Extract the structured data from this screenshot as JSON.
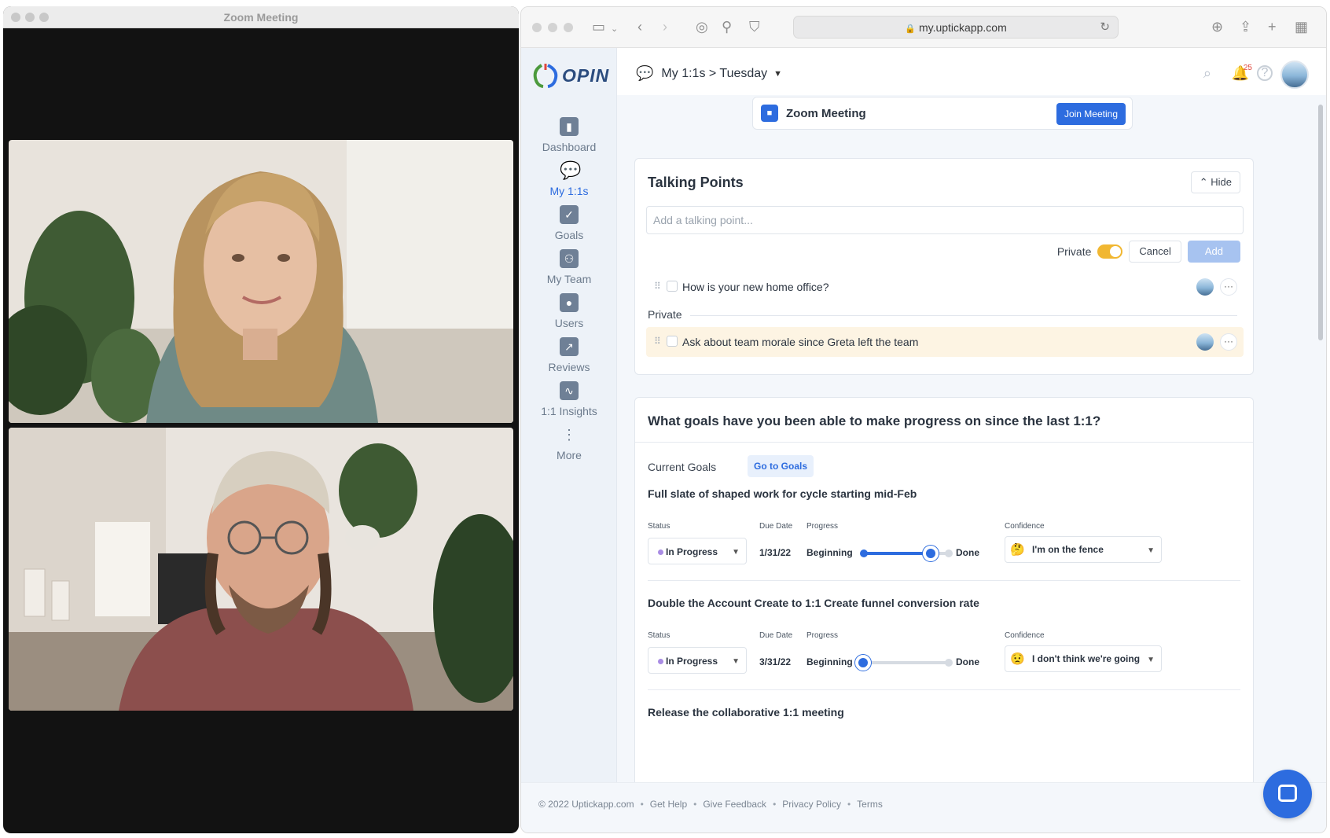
{
  "zoom": {
    "window_title": "Zoom Meeting"
  },
  "browser": {
    "url": "my.uptickapp.com"
  },
  "app": {
    "logo_text": "OPIN",
    "nav": [
      {
        "label": "Dashboard",
        "icon": "chart-icon"
      },
      {
        "label": "My 1:1s",
        "icon": "chat-icon"
      },
      {
        "label": "Goals",
        "icon": "check-icon"
      },
      {
        "label": "My Team",
        "icon": "team-icon"
      },
      {
        "label": "Users",
        "icon": "user-icon"
      },
      {
        "label": "Reviews",
        "icon": "trend-icon"
      },
      {
        "label": "1:1 Insights",
        "icon": "pulse-icon"
      },
      {
        "label": "More",
        "icon": "more-icon"
      }
    ],
    "breadcrumb": "My 1:1s > Tuesday",
    "notifications_count": "25",
    "zoom_card": {
      "title": "Zoom Meeting",
      "join_label": "Join Meeting"
    },
    "talking_points": {
      "title": "Talking Points",
      "hide_label": "Hide",
      "input_placeholder": "Add a talking point...",
      "private_label": "Private",
      "cancel_label": "Cancel",
      "add_label": "Add",
      "section_private": "Private",
      "items": [
        {
          "text": "How is your new home office?"
        },
        {
          "text": "Ask about team morale since Greta left the team"
        }
      ]
    },
    "goals": {
      "question": "What goals have you been able to make progress on since the last 1:1?",
      "current_goals_label": "Current Goals",
      "go_to_goals_label": "Go to Goals",
      "labels": {
        "status": "Status",
        "due_date": "Due Date",
        "progress": "Progress",
        "confidence": "Confidence",
        "beginning": "Beginning",
        "done": "Done"
      },
      "list": [
        {
          "name": "Full slate of shaped work for cycle starting mid-Feb",
          "status": "In Progress",
          "due": "1/31/22",
          "progress": 0.8,
          "confidence": "I'm on the fence"
        },
        {
          "name": "Double the Account Create to 1:1 Create funnel conversion rate",
          "status": "In Progress",
          "due": "3/31/22",
          "progress": 0.0,
          "confidence": "I don't think we're going"
        },
        {
          "name": "Release the collaborative 1:1 meeting"
        }
      ]
    },
    "footer": {
      "copyright": "© 2022 Uptickapp.com",
      "links": [
        "Get Help",
        "Give Feedback",
        "Privacy Policy",
        "Terms"
      ]
    }
  }
}
